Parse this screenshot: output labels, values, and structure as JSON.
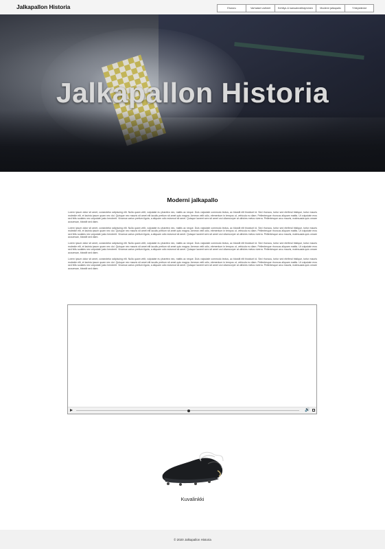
{
  "header": {
    "brand": "Jalkapallon Historia",
    "nav": [
      {
        "label": "Etusivu"
      },
      {
        "label": "Varhaiset vaiheet"
      },
      {
        "label": "Kehitys & kansainvälistyminen"
      },
      {
        "label": "Moderni jalkapallo"
      },
      {
        "label": "Yhteystiedot"
      }
    ]
  },
  "hero": {
    "title": "Jalkapallon Historia"
  },
  "main": {
    "section_title": "Moderni jalkapallo",
    "paragraphs": [
      "Lorem ipsum dolor sit amet, consectetur adipiscing elit. Nulla quam velit, vulputate eu pharetra nec, mattis ac neque. Duis vulputate commodo lectus, ac blandit elit tincidunt id. Sed rhoncus, tortor sed eleifend tristique, tortor mauris molestie elit, et lacinia ipsum quam nec dui. Quisque nec mauris sit amet elit iaculis pretium sit amet quis magna. Aenean velit odio, elementum in tempus ut, vehicula eu diam. Pellentesque rhoncus aliquam mattis. Ut vulputate eros sed felis sodales nec vulputate justo hendrerit. Vivamus varius pretium ligula, a aliquam odio euismod sit amet. Quisque laoreet sem sit amet orci ullamcorper at ultricies metus viverra. Pellentesque arcu mauris, malesuada quis ornare accumsan, blandit sed diam.",
      "Lorem ipsum dolor sit amet, consectetur adipiscing elit. Nulla quam velit, vulputate eu pharetra nec, mattis ac neque. Duis vulputate commodo lectus, ac blandit elit tincidunt id. Sed rhoncus, tortor sed eleifend tristique, tortor mauris molestie elit, et lacinia ipsum quam nec dui. Quisque nec mauris sit amet elit iaculis pretium sit amet quis magna. Aenean velit odio, elementum in tempus ut, vehicula eu diam. Pellentesque rhoncus aliquam mattis. Ut vulputate eros sed felis sodales nec vulputate justo hendrerit. Vivamus varius pretium ligula, a aliquam odio euismod sit amet. Quisque laoreet sem sit amet orci ullamcorper at ultricies metus viverra. Pellentesque arcu mauris, malesuada quis ornare accumsan, blandit sed diam.",
      "Lorem ipsum dolor sit amet, consectetur adipiscing elit. Nulla quam velit, vulputate eu pharetra nec, mattis ac neque. Duis vulputate commodo lectus, ac blandit elit tincidunt id. Sed rhoncus, tortor sed eleifend tristique, tortor mauris molestie elit, et lacinia ipsum quam nec dui. Quisque nec mauris sit amet elit iaculis pretium sit amet quis magna. Aenean velit odio, elementum in tempus ut, vehicula eu diam. Pellentesque rhoncus aliquam mattis. Ut vulputate eros sed felis sodales nec vulputate justo hendrerit. Vivamus varius pretium ligula, a aliquam odio euismod sit amet. Quisque laoreet sem sit amet orci ullamcorper at ultricies metus viverra. Pellentesque arcu mauris, malesuada quis ornare accumsan, blandit sed diam.",
      "Lorem ipsum dolor sit amet, consectetur adipiscing elit. Nulla quam velit, vulputate eu pharetra nec, mattis ac neque. Duis vulputate commodo lectus, ac blandit elit tincidunt id. Sed rhoncus, tortor sed eleifend tristique, tortor mauris molestie elit, et lacinia ipsum quam nec dui. Quisque nec mauris sit amet elit iaculis pretium sit amet quis magna. Aenean velit odio, elementum in tempus ut, vehicula eu diam. Pellentesque rhoncus aliquam mattis. Ut vulputate eros sed felis sodales nec vulputate justo hendrerit. Vivamus varius pretium ligula, a aliquam odio euismod sit amet. Quisque laoreet sem sit amet orci ullamcorper at ultricies metus viverra. Pellentesque arcu mauris, malesuada quis ornare accumsan, blandit sed diam."
    ],
    "image_caption": "Kuvalinkki"
  },
  "video": {
    "controls": [
      "play-icon",
      "progress-bar",
      "volume-icon",
      "fullscreen-icon"
    ]
  },
  "footer": {
    "text": "© 2020 Jalkapallon Historia"
  },
  "colors": {
    "topbar_bg": "#f4f4f4",
    "footer_bg": "#f1f1f1",
    "hero_title": "#d9d9d9"
  }
}
